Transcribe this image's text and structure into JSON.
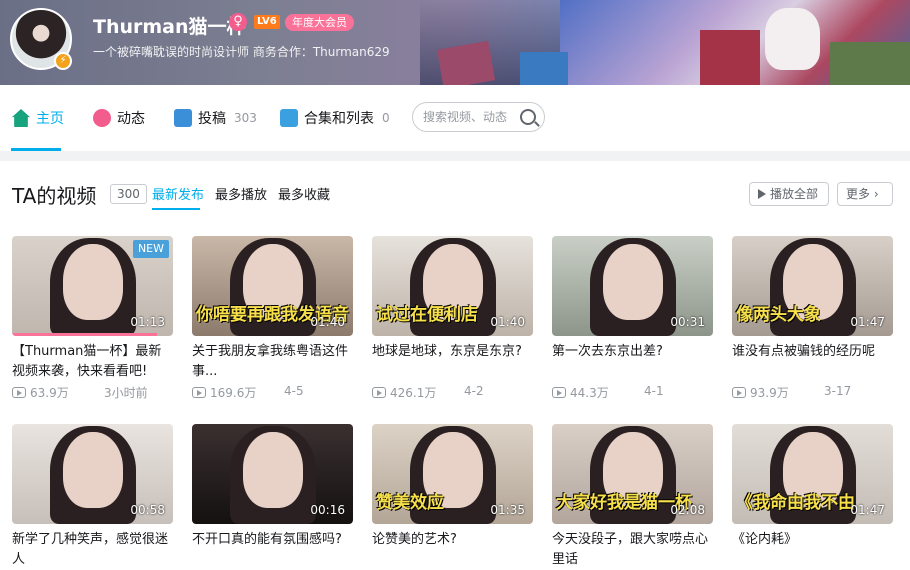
{
  "profile": {
    "username": "Thurman猫一杯",
    "gender_icon": "♀",
    "level": "LV6",
    "vip_badge": "年度大会员",
    "signature": "一个被碎嘴耽误的时尚设计师 商务合作：Thurman629"
  },
  "nav": {
    "tabs": [
      {
        "label": "主页",
        "icon": "home-icon",
        "count": ""
      },
      {
        "label": "动态",
        "icon": "dynamic-icon",
        "count": ""
      },
      {
        "label": "投稿",
        "icon": "upload-icon",
        "count": "303"
      },
      {
        "label": "合集和列表",
        "icon": "collection-icon",
        "count": "0"
      }
    ],
    "search_placeholder": "搜索视频、动态"
  },
  "videos_section": {
    "title": "TA的视频",
    "count": "300",
    "sort_options": [
      "最新发布",
      "最多播放",
      "最多收藏"
    ],
    "play_all": "播放全部",
    "more": "更多"
  },
  "videos": [
    {
      "title": "【Thurman猫一杯】最新视频来袭，快来看看吧!",
      "duration": "01:13",
      "views": "63.9万",
      "date": "3小时前",
      "badge": "NEW",
      "caption": "",
      "progress": 0.9
    },
    {
      "title": "关于我朋友拿我练粤语这件事...",
      "duration": "01:40",
      "views": "169.6万",
      "date": "4-5",
      "badge": "",
      "caption": "你唔要再跟我发语音"
    },
    {
      "title": "地球是地球，东京是东京?",
      "duration": "01:40",
      "views": "426.1万",
      "date": "4-2",
      "badge": "",
      "caption": "试过在便利店"
    },
    {
      "title": "第一次去东京出差?",
      "duration": "00:31",
      "views": "44.3万",
      "date": "4-1",
      "badge": "",
      "caption": ""
    },
    {
      "title": "谁没有点被骗钱的经历呢",
      "duration": "01:47",
      "views": "93.9万",
      "date": "3-17",
      "badge": "",
      "caption": "像两头大象"
    },
    {
      "title": "新学了几种笑声，感觉很迷人",
      "duration": "00:58",
      "views": "",
      "date": "",
      "badge": "",
      "caption": ""
    },
    {
      "title": "不开口真的能有氛围感吗?",
      "duration": "00:16",
      "views": "",
      "date": "",
      "badge": "",
      "caption": ""
    },
    {
      "title": "论赞美的艺术?",
      "duration": "01:35",
      "views": "",
      "date": "",
      "badge": "",
      "caption": "赞美效应"
    },
    {
      "title": "今天没段子，跟大家唠点心里话",
      "duration": "02:08",
      "views": "",
      "date": "",
      "badge": "",
      "caption": "大家好我是猫一杯"
    },
    {
      "title": "《论内耗》",
      "duration": "01:47",
      "views": "",
      "date": "",
      "badge": "",
      "caption": "《我命由我不由"
    }
  ],
  "colors": {
    "accent": "#00aeec",
    "pink": "#fb7299"
  }
}
